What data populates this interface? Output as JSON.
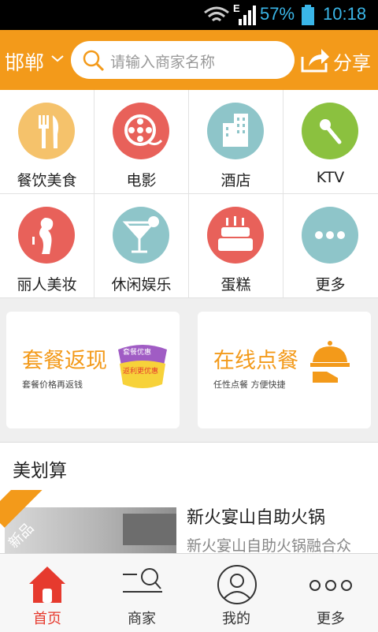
{
  "status": {
    "network": "E",
    "battery": "57%",
    "time": "10:18"
  },
  "header": {
    "city": "邯郸",
    "search_placeholder": "请输入商家名称",
    "share_label": "分享"
  },
  "categories": [
    {
      "label": "餐饮美食",
      "icon": "cutlery-icon",
      "color": "#f5c26b"
    },
    {
      "label": "电影",
      "icon": "film-reel-icon",
      "color": "#e8615a"
    },
    {
      "label": "酒店",
      "icon": "building-icon",
      "color": "#8ec5c9"
    },
    {
      "label": "KTV",
      "icon": "microphone-icon",
      "color": "#8bc13f"
    },
    {
      "label": "丽人美妆",
      "icon": "woman-icon",
      "color": "#e8615a"
    },
    {
      "label": "休闲娱乐",
      "icon": "cocktail-icon",
      "color": "#8ec5c9"
    },
    {
      "label": "蛋糕",
      "icon": "cake-icon",
      "color": "#e8615a"
    },
    {
      "label": "更多",
      "icon": "more-dots-icon",
      "color": "#8ec5c9"
    }
  ],
  "promos": [
    {
      "title": "套餐返现",
      "subtitle": "套餐价格再返钱",
      "badge_top": "套餐优惠",
      "badge_bottom": "返利更优惠"
    },
    {
      "title": "在线点餐",
      "subtitle": "任性点餐 方便快捷"
    }
  ],
  "section": {
    "title": "美划算"
  },
  "deal": {
    "badge": "新品",
    "title": "新火宴山自助火锅",
    "desc": "新火宴山自助火锅融合众"
  },
  "nav": [
    {
      "label": "首页",
      "icon": "home-icon",
      "active": true
    },
    {
      "label": "商家",
      "icon": "merchant-search-icon",
      "active": false
    },
    {
      "label": "我的",
      "icon": "user-icon",
      "active": false
    },
    {
      "label": "更多",
      "icon": "more-dots-icon",
      "active": false
    }
  ],
  "colors": {
    "accent": "#f39a1a",
    "active": "#e63a2e"
  }
}
